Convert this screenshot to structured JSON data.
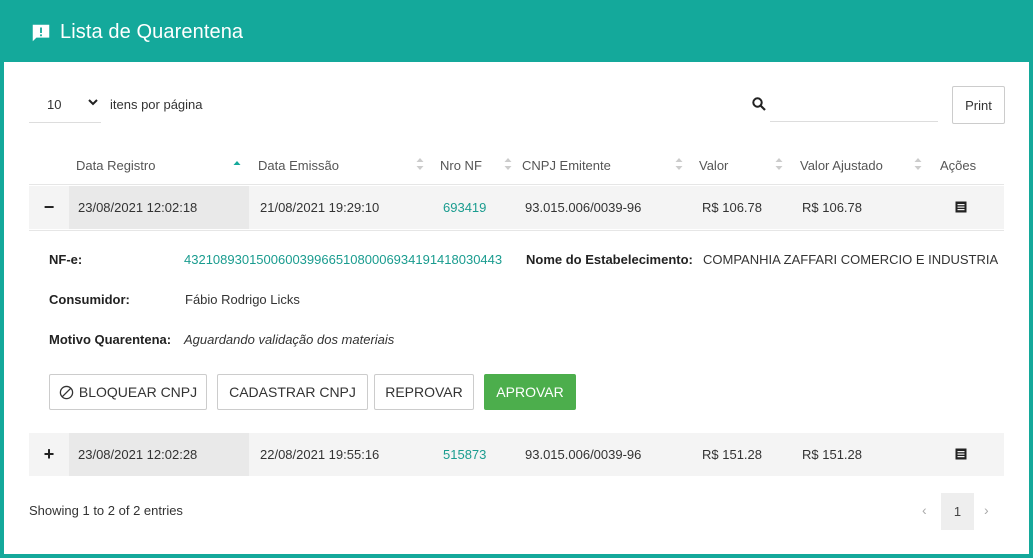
{
  "header": {
    "title": "Lista de Quarentena",
    "icon": "alert-message-icon",
    "color": "#14a99b"
  },
  "controls": {
    "per_page_value": "10",
    "per_page_label": "itens por página",
    "search_placeholder": "",
    "print_label": "Print"
  },
  "table": {
    "columns": [
      "Data Registro",
      "Data Emissão",
      "Nro NF",
      "CNPJ Emitente",
      "Valor",
      "Valor Ajustado",
      "Ações"
    ],
    "sorted_column": "Data Registro",
    "rows": [
      {
        "toggle": "−",
        "data_registro": "23/08/2021 12:02:18",
        "data_emissao": "21/08/2021 19:29:10",
        "nro_nf": "693419",
        "cnpj": "93.015.006/0039-96",
        "valor": "R$ 106.78",
        "valor_ajustado": "R$ 106.78",
        "expanded": true
      },
      {
        "toggle": "+",
        "data_registro": "23/08/2021 12:02:28",
        "data_emissao": "22/08/2021 19:55:16",
        "nro_nf": "515873",
        "cnpj": "93.015.006/0039-96",
        "valor": "R$ 151.28",
        "valor_ajustado": "R$ 151.28",
        "expanded": false
      }
    ]
  },
  "detail": {
    "nfe_label": "NF-e:",
    "nfe_value": "43210893015006003996651080006934191418030443",
    "estab_label": "Nome do Estabelecimento:",
    "estab_value": "COMPANHIA ZAFFARI COMERCIO E INDUSTRIA",
    "consumidor_label": "Consumidor:",
    "consumidor_value": "Fábio Rodrigo Licks",
    "motivo_label": "Motivo Quarentena:",
    "motivo_value": "Aguardando validação dos materiais",
    "buttons": {
      "bloquear": "BLOQUEAR CNPJ",
      "cadastrar": "CADASTRAR CNPJ",
      "reprovar": "REPROVAR",
      "aprovar": "APROVAR"
    }
  },
  "footer": {
    "showing": "Showing 1 to 2 of 2 entries",
    "prev": "‹",
    "page": "1",
    "next": "›"
  }
}
